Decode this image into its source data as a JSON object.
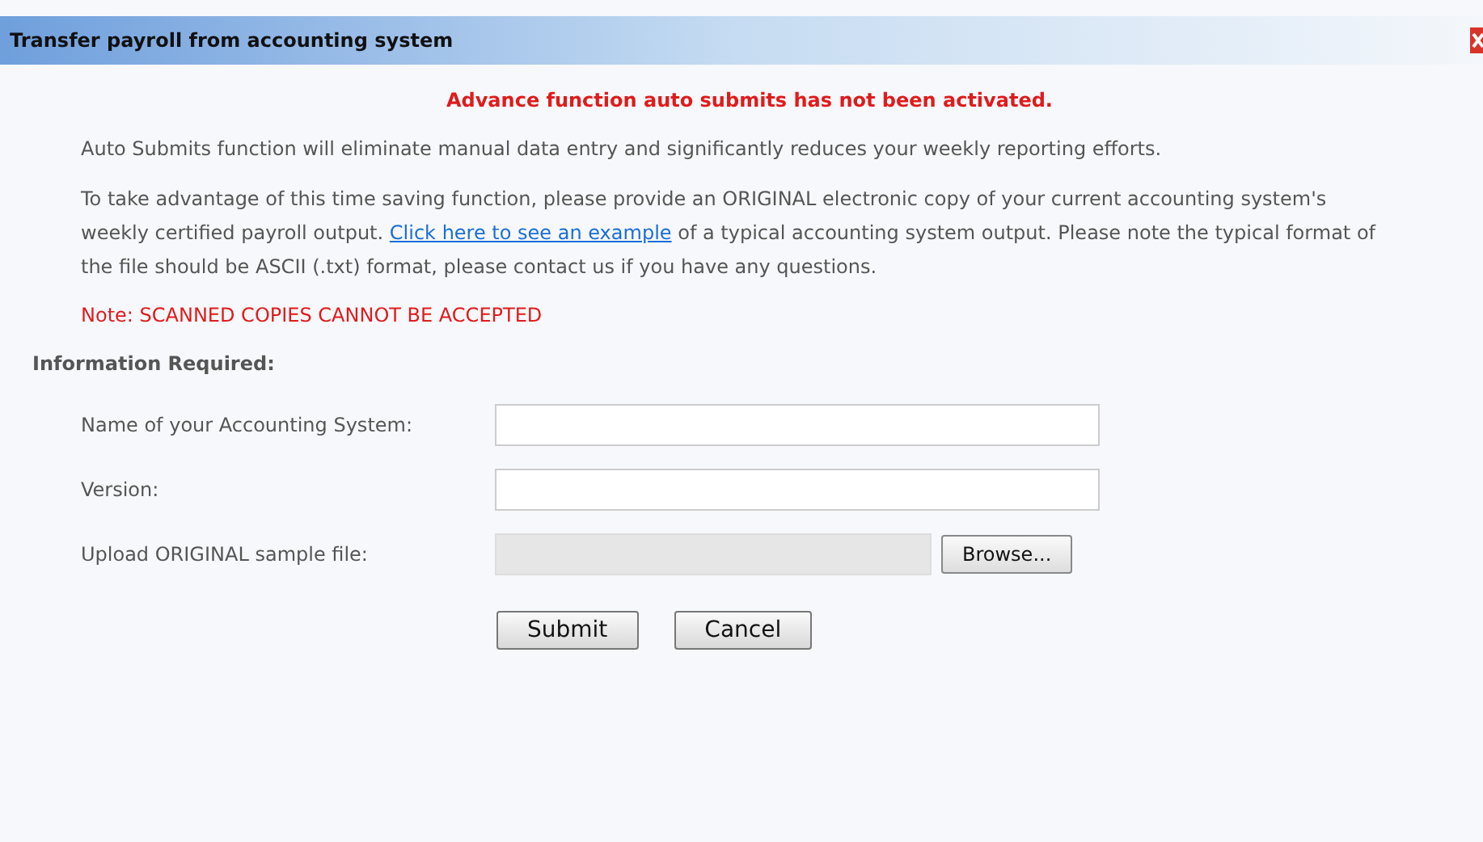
{
  "window": {
    "title": "Transfer payroll from accounting system"
  },
  "alert": "Advance function auto submits has not been activated.",
  "intro": "Auto Submits function will eliminate manual data entry and significantly reduces your weekly reporting efforts.",
  "instructions": {
    "before": "To take advantage of this time saving function, please provide an ORIGINAL electronic copy of your current accounting system's weekly certified payroll output.",
    "link": "Click here to see an example",
    "after": "of a typical accounting system output. Please note the typical format of the file should be ASCII (.txt) format, please contact us if you have any questions."
  },
  "note": "Note: SCANNED COPIES CANNOT BE ACCEPTED",
  "section_title": "Information Required:",
  "fields": [
    {
      "kind": "text",
      "label": "Name of your Accounting System:",
      "disabled": false
    },
    {
      "kind": "text",
      "label": "Version:",
      "disabled": false
    },
    {
      "kind": "file",
      "label": "Upload ORIGINAL sample file:",
      "disabled": true,
      "button": "Browse..."
    }
  ],
  "buttons": [
    "Submit",
    "Cancel"
  ]
}
